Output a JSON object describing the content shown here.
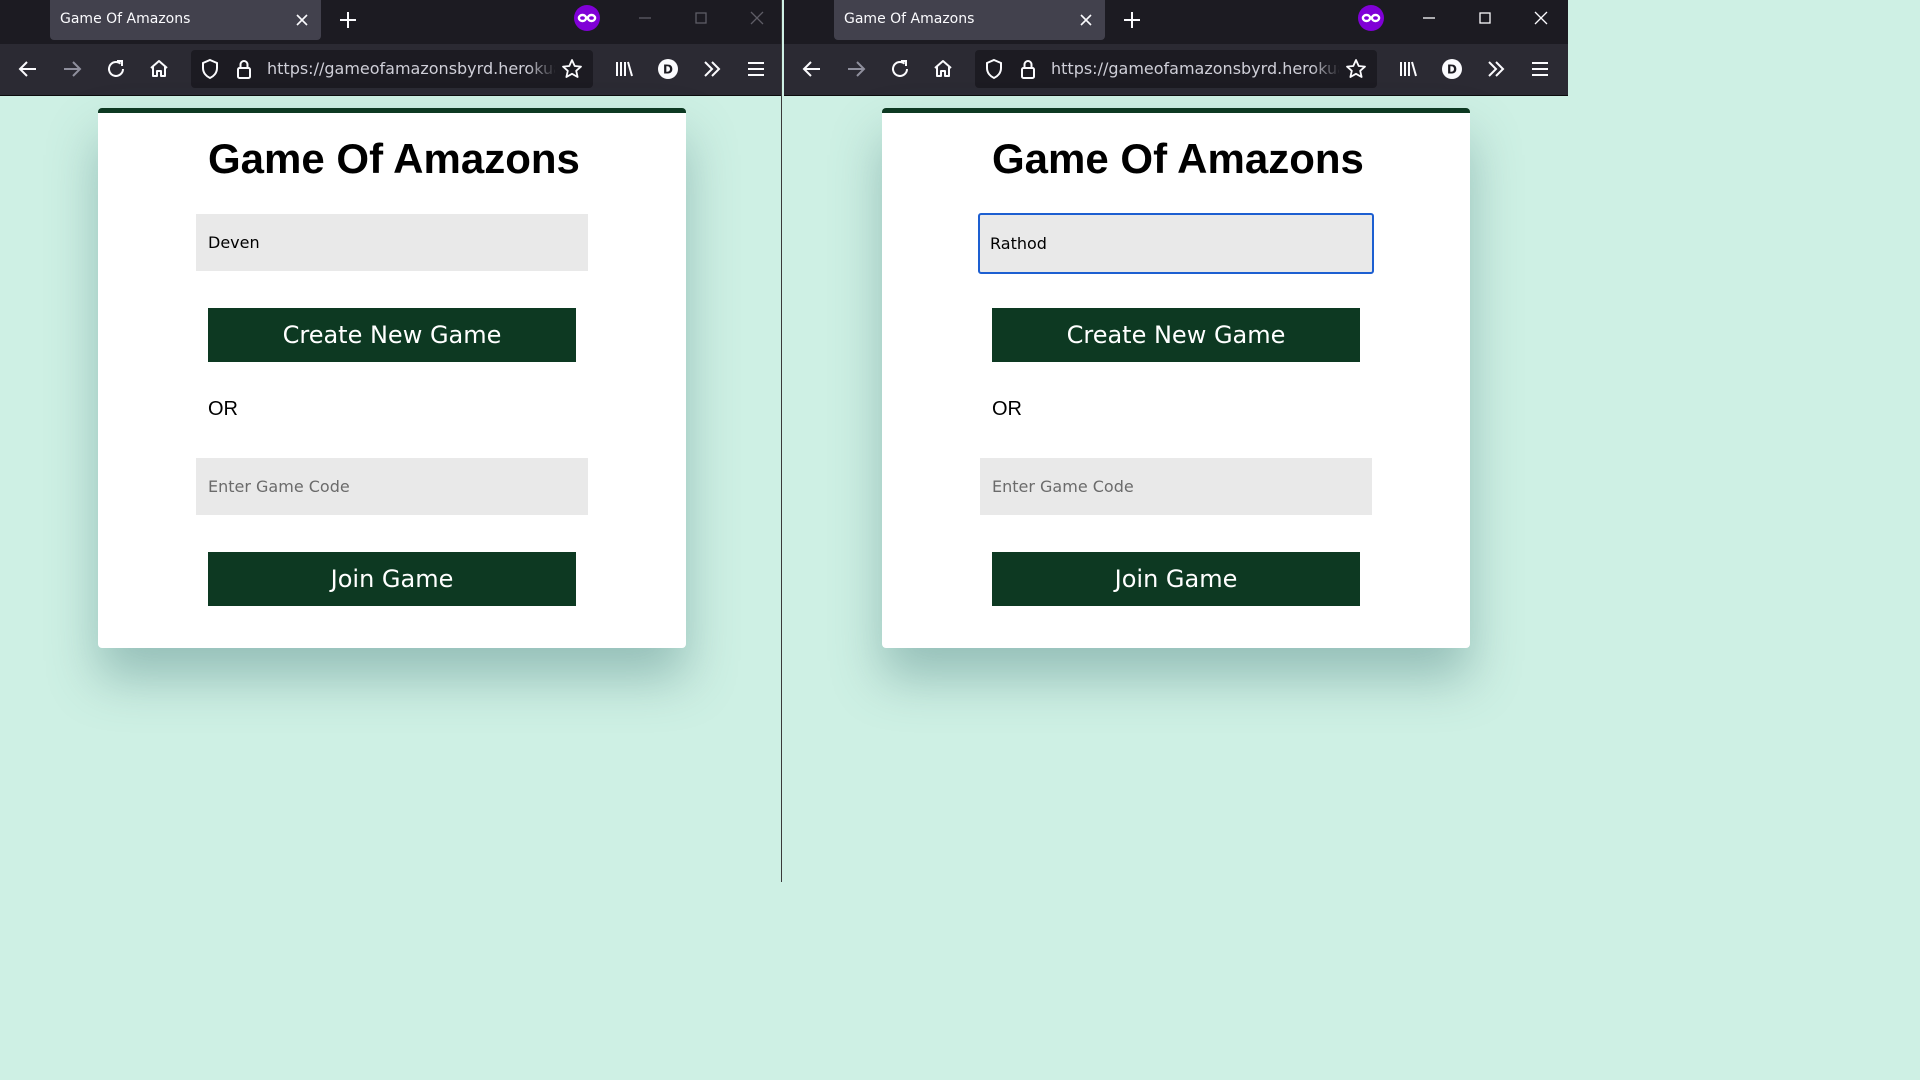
{
  "windows": [
    {
      "tab_title": "Game Of Amazons",
      "url": "https://gameofamazonsbyrd.herokuapp.com",
      "profile_initial": "D",
      "app": {
        "title": "Game Of Amazons",
        "name_value": "Deven",
        "name_focused": false,
        "create_label": "Create New Game",
        "or_label": "OR",
        "code_placeholder": "Enter Game Code",
        "join_label": "Join Game"
      }
    },
    {
      "tab_title": "Game Of Amazons",
      "url": "https://gameofamazonsbyrd.herokuapp.com",
      "profile_initial": "D",
      "app": {
        "title": "Game Of Amazons",
        "name_value": "Rathod",
        "name_focused": true,
        "create_label": "Create New Game",
        "or_label": "OR",
        "code_placeholder": "Enter Game Code",
        "join_label": "Join Game"
      }
    }
  ],
  "colors": {
    "page_background": "#cef0e4",
    "button": "#0d3922",
    "focus_ring": "#1d5fd1",
    "private_mask": "#8000d7"
  }
}
